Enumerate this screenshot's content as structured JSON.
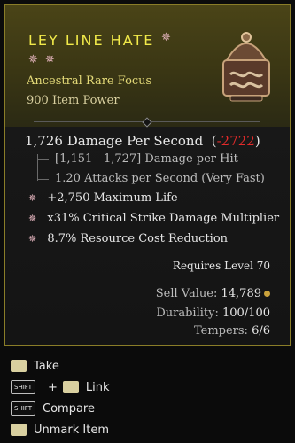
{
  "item": {
    "name": "LEY LINE HATE",
    "title_glyph": "✵",
    "stars": "✵✵",
    "type": "Ancestral Rare Focus",
    "item_power": "900 Item Power",
    "dps_text": "1,726 Damage Per Second",
    "dps_delta": "-2722",
    "damage_per_hit": "[1,151 - 1,727] Damage per Hit",
    "attacks_per_second": "1.20 Attacks per Second (Very Fast)",
    "affixes": [
      "+2,750 Maximum Life",
      "x31% Critical Strike Damage Multiplier",
      "8.7% Resource Cost Reduction"
    ],
    "affix_bullet": "✵",
    "requirement": "Requires Level 70",
    "sell_label": "Sell Value:",
    "sell_value": "14,789",
    "durability_label": "Durability:",
    "durability_value": "100/100",
    "tempers_label": "Tempers:",
    "tempers_value": "6/6",
    "colors": {
      "title": "#f2ea4a",
      "border": "#8a7d28",
      "negative": "#e22b2b",
      "affix_bullet": "#e9b8c2"
    }
  },
  "actions": [
    {
      "label": "Take"
    },
    {
      "modifier": "SHIFT",
      "plus": "+",
      "label": "Link"
    },
    {
      "modifier": "SHIFT",
      "label": "Compare"
    },
    {
      "label": "Unmark Item"
    }
  ]
}
